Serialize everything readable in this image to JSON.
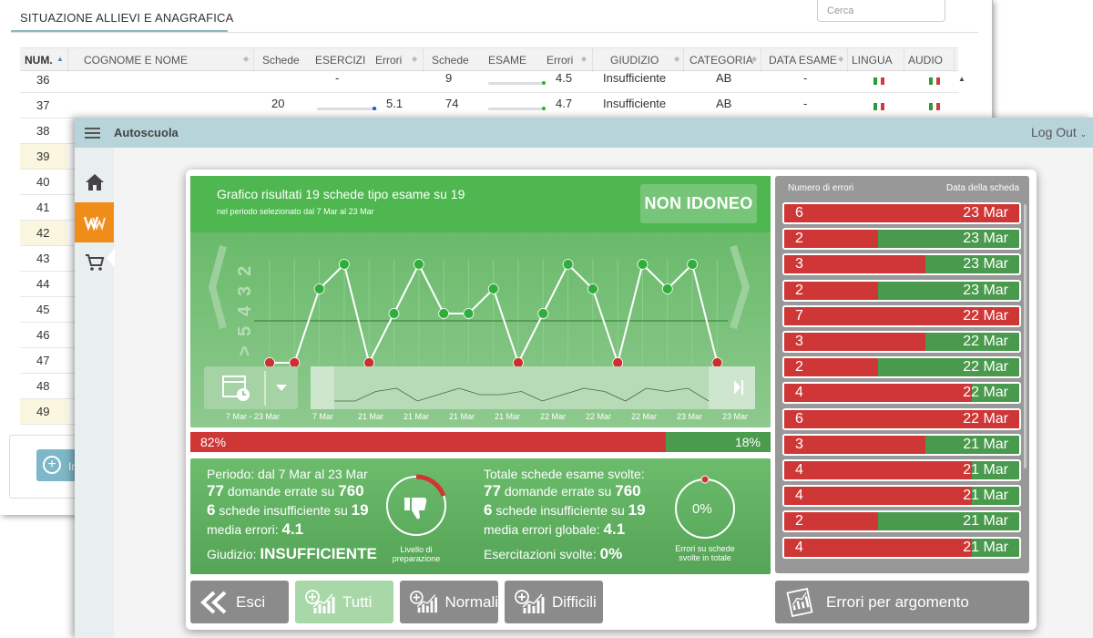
{
  "background_window": {
    "title": "SITUAZIONE ALLIEVI E ANAGRAFICA",
    "search_placeholder": "Cerca",
    "table_headers": [
      "NUM.",
      "COGNOME E NOME",
      "Schede",
      "ESERCIZI",
      "Errori",
      "Schede",
      "ESAME",
      "Errori",
      "GIUDIZIO",
      "CATEGORIA",
      "DATA ESAME",
      "LINGUA",
      "AUDIO"
    ],
    "rows": [
      {
        "num": "36",
        "schede_es": "",
        "bar_es": "-",
        "errori_es": "",
        "schede_ex": "9",
        "errori_ex": "4.5",
        "giudizio": "Insufficiente",
        "categoria": "AB",
        "data": "-"
      },
      {
        "num": "37",
        "schede_es": "20",
        "bar_es": "",
        "errori_es": "5.1",
        "schede_ex": "74",
        "errori_ex": "4.7",
        "giudizio": "Insufficiente",
        "categoria": "AB",
        "data": "-"
      },
      {
        "num": "38"
      },
      {
        "num": "39"
      },
      {
        "num": "40"
      },
      {
        "num": "41"
      },
      {
        "num": "42"
      },
      {
        "num": "43"
      },
      {
        "num": "44"
      },
      {
        "num": "45"
      },
      {
        "num": "46"
      },
      {
        "num": "47"
      },
      {
        "num": "48"
      },
      {
        "num": "49"
      }
    ],
    "add_button_label": "In"
  },
  "app": {
    "title": "Autoscuola",
    "logout_label": "Log Out",
    "sidebar": [
      "home-icon",
      "quiz-icon",
      "cart-icon"
    ],
    "colors": {
      "accent": "#f08c1a",
      "topbar": "#b7d4db",
      "green": "#4eb74f",
      "red": "#cf3737"
    }
  },
  "results": {
    "title": "Grafico risultati 19 schede tipo esame su 19",
    "subtitle": "nel periodo selezionato dal 7 Mar al 23 Mar",
    "verdict": "NON IDONEO",
    "y_axis_labels": [
      "2",
      "3",
      "4",
      "5",
      ">"
    ],
    "range_label": "7 Mar - 23 Mar",
    "dates": [
      "7 Mar",
      "21 Mar",
      "21 Mar",
      "21 Mar",
      "21 Mar",
      "22 Mar",
      "22 Mar",
      "22 Mar",
      "23 Mar",
      "23 Mar"
    ],
    "wrong_percent_label": "82%",
    "right_percent_label": "18%",
    "wrong_percent": 82
  },
  "chart_data": {
    "type": "line",
    "title": "Grafico risultati 19 schede tipo esame su 19",
    "values": [
      6,
      6,
      3,
      2,
      6,
      4,
      2,
      4,
      4,
      3,
      6,
      4,
      2,
      3,
      6,
      2,
      3,
      2,
      6
    ],
    "passed": [
      false,
      false,
      true,
      true,
      false,
      true,
      true,
      true,
      true,
      true,
      false,
      true,
      true,
      true,
      false,
      true,
      true,
      true,
      false
    ],
    "y_axis_labels": [
      "2",
      "3",
      "4",
      "5",
      ">"
    ],
    "colors": {
      "pass": "#2fae3a",
      "fail": "#cc2f2f"
    }
  },
  "stats": {
    "period_label": "Periodo: dal 7 Mar al 23 Mar",
    "wrong_num": "77",
    "wrong_text": "domande errate su",
    "wrong_total": "760",
    "insuff_num": "6",
    "insuff_text": "schede insufficiente su",
    "insuff_total": "19",
    "media_label": "media errori:",
    "media_value": "4.1",
    "giudizio_label": "Giudizio:",
    "giudizio_value": "INSUFFICIENTE",
    "gauge1_label_1": "Livello di",
    "gauge1_label_2": "preparazione",
    "total_label": "Totale schede esame svolte:",
    "total_wrong_num": "77",
    "total_wrong_text": "domande errate su",
    "total_wrong_total": "760",
    "total_insuff_num": "6",
    "total_insuff_text": "schede insufficiente su",
    "total_insuff_total": "19",
    "global_media_label": "media errori globale:",
    "global_media_value": "4.1",
    "exercises_label": "Esercitazioni svolte:",
    "exercises_value": "0%",
    "gauge2_value": "0%",
    "gauge2_label_1": "Errori su schede",
    "gauge2_label_2": "svolte in totale"
  },
  "buttons": {
    "exit": "Esci",
    "all": "Tutti",
    "normal": "Normali",
    "hard": "Difficili",
    "by_topic": "Errori per argomento"
  },
  "errors": {
    "header_left": "Numero di errori",
    "header_right": "Data della scheda",
    "rows": [
      {
        "errors": "6",
        "date": "23 Mar",
        "red_fraction": 1.0
      },
      {
        "errors": "2",
        "date": "23 Mar",
        "red_fraction": 0.4
      },
      {
        "errors": "3",
        "date": "23 Mar",
        "red_fraction": 0.6
      },
      {
        "errors": "2",
        "date": "23 Mar",
        "red_fraction": 0.4
      },
      {
        "errors": "7",
        "date": "22 Mar",
        "red_fraction": 1.0
      },
      {
        "errors": "3",
        "date": "22 Mar",
        "red_fraction": 0.6
      },
      {
        "errors": "2",
        "date": "22 Mar",
        "red_fraction": 0.4
      },
      {
        "errors": "4",
        "date": "22 Mar",
        "red_fraction": 0.8
      },
      {
        "errors": "6",
        "date": "22 Mar",
        "red_fraction": 1.0
      },
      {
        "errors": "3",
        "date": "21 Mar",
        "red_fraction": 0.6
      },
      {
        "errors": "4",
        "date": "21 Mar",
        "red_fraction": 0.8
      },
      {
        "errors": "4",
        "date": "21 Mar",
        "red_fraction": 0.8
      },
      {
        "errors": "2",
        "date": "21 Mar",
        "red_fraction": 0.4
      },
      {
        "errors": "4",
        "date": "21 Mar",
        "red_fraction": 0.8
      }
    ]
  }
}
